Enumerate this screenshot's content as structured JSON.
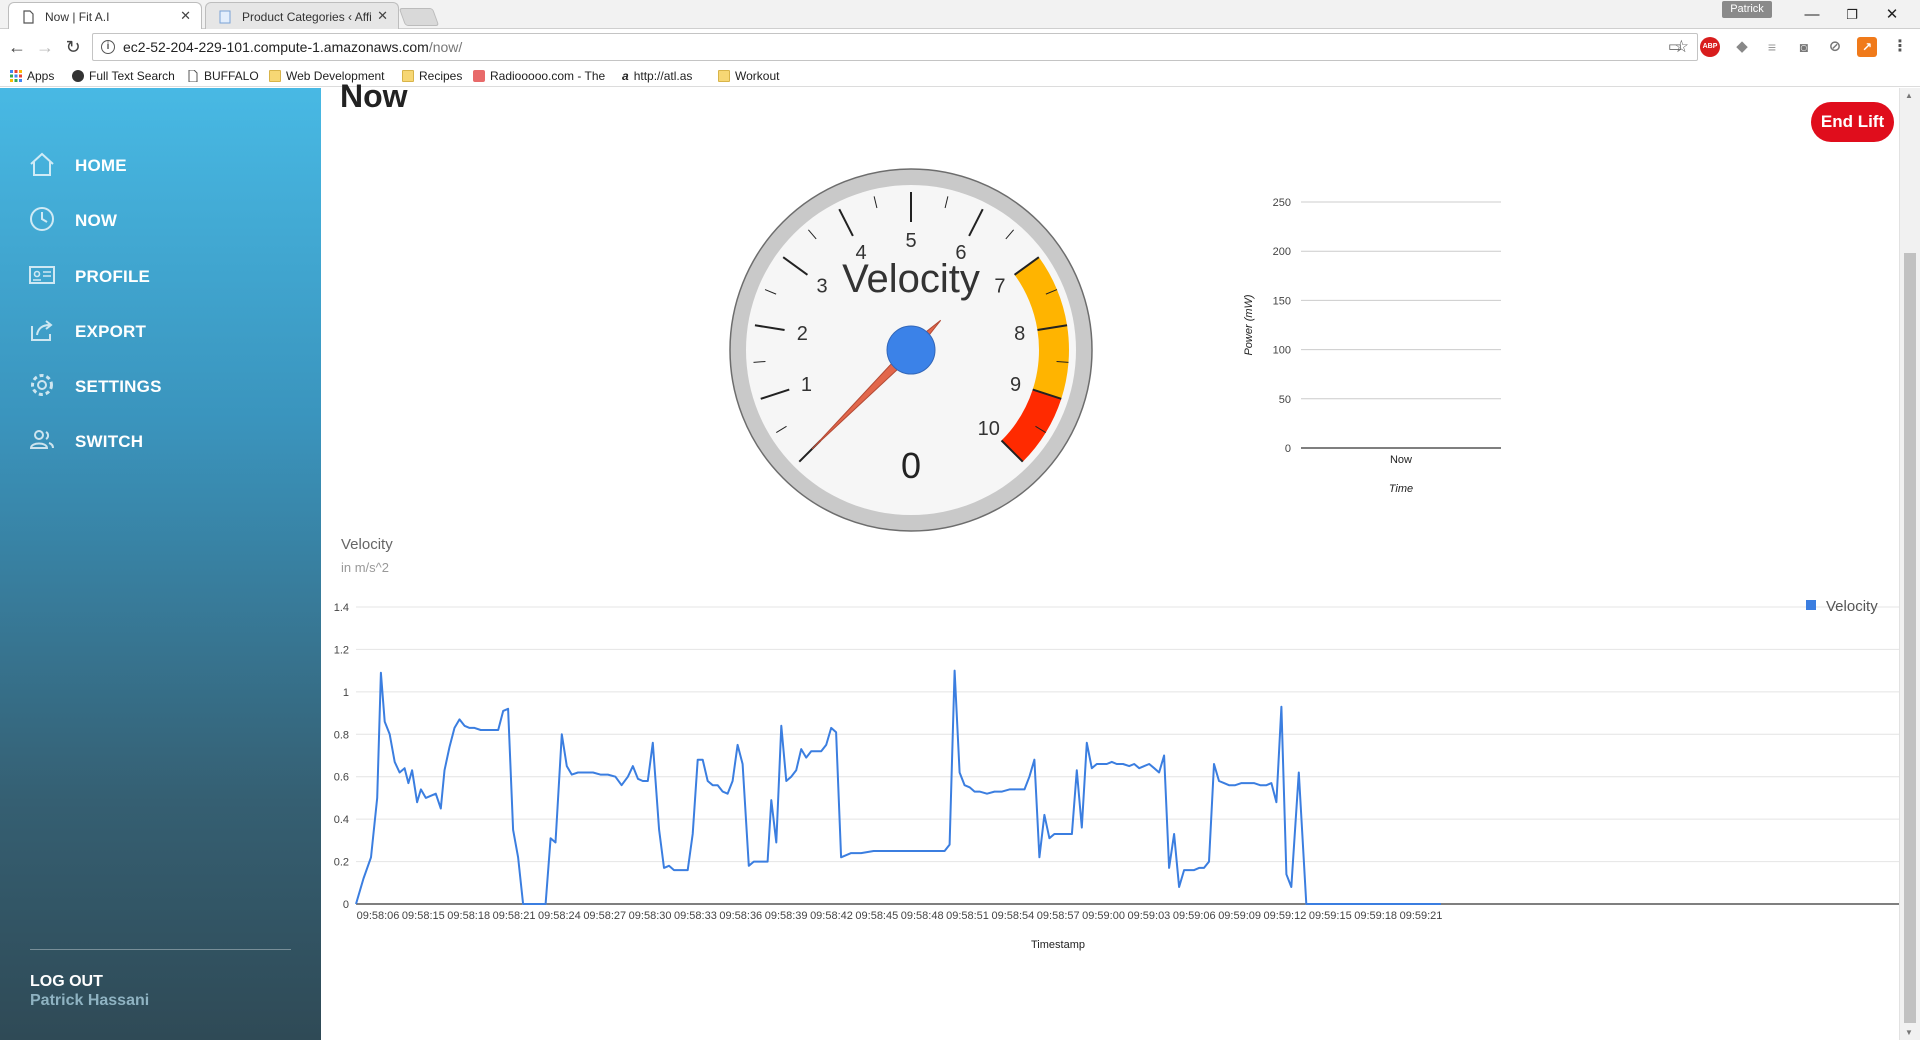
{
  "browser": {
    "tabs": [
      {
        "title": "Now | Fit A.I",
        "active": true
      },
      {
        "title": "Product Categories ‹ Affi",
        "active": false
      }
    ],
    "profile": "Patrick",
    "url_host": "ec2-52-204-229-101.compute-1.amazonaws.com",
    "url_path": "/now/",
    "bookmarks": [
      "Apps",
      "Full Text Search",
      "BUFFALO",
      "Web Development",
      "Recipes",
      "Radiooooo.com - The",
      "http://atl.as",
      "Workout"
    ],
    "extension_icons": [
      "cast-icon",
      "adblock-icon",
      "extension-icon",
      "camera-icon",
      "compass-icon",
      "trend-icon",
      "menu-icon"
    ]
  },
  "sidebar": {
    "items": [
      {
        "label": "HOME",
        "icon": "home-icon"
      },
      {
        "label": "NOW",
        "icon": "clock-icon"
      },
      {
        "label": "PROFILE",
        "icon": "id-card-icon"
      },
      {
        "label": "EXPORT",
        "icon": "export-icon"
      },
      {
        "label": "SETTINGS",
        "icon": "gear-icon"
      },
      {
        "label": "SWITCH",
        "icon": "users-icon"
      }
    ],
    "logout_label": "LOG OUT",
    "user_name": "Patrick Hassani"
  },
  "page": {
    "title": "Now",
    "end_lift_label": "End Lift"
  },
  "chart_data": [
    {
      "type": "gauge",
      "title": "Velocity",
      "min": 0,
      "max": 10,
      "value": 0,
      "value_label": "0",
      "major_ticks": [
        "0",
        "1",
        "2",
        "3",
        "4",
        "5",
        "6",
        "7",
        "8",
        "9",
        "10"
      ],
      "bands": [
        {
          "from": 7,
          "to": 9,
          "color": "#ffb400"
        },
        {
          "from": 9,
          "to": 10,
          "color": "#ff2a00"
        }
      ],
      "needle_color": "#e2674b",
      "hub_color": "#3b82e8"
    },
    {
      "type": "bar",
      "categories": [
        "Now"
      ],
      "values": [
        0
      ],
      "xlabel": "Time",
      "ylabel": "Power (mW)",
      "ylim": [
        0,
        250
      ],
      "yticks": [
        0,
        50,
        100,
        150,
        200,
        250
      ],
      "grid": true
    },
    {
      "type": "line",
      "title": "Velocity",
      "subtitle": "in m/s^2",
      "xlabel": "Timestamp",
      "ylabel": "",
      "ylim": [
        0,
        1.4
      ],
      "yticks": [
        0,
        0.2,
        0.4,
        0.6,
        0.8,
        1,
        1.2,
        1.4
      ],
      "ytick_labels": [
        "0",
        "0.2",
        "0.4",
        "0.6",
        "0.8",
        "1",
        "1.2",
        "1.4"
      ],
      "xlim": [
        0,
        75
      ],
      "xtick_labels": [
        "09:58:06",
        "09:58:15",
        "09:58:18",
        "09:58:21",
        "09:58:24",
        "09:58:27",
        "09:58:30",
        "09:58:33",
        "09:58:36",
        "09:58:39",
        "09:58:42",
        "09:58:45",
        "09:58:48",
        "09:58:51",
        "09:58:54",
        "09:58:57",
        "09:59:00",
        "09:59:03",
        "09:59:06",
        "09:59:09",
        "09:59:12",
        "09:59:15",
        "09:59:18",
        "09:59:21"
      ],
      "grid": true,
      "legend": "right",
      "series": [
        {
          "name": "Velocity",
          "color": "#3b7ee0",
          "points": [
            [
              0,
              0
            ],
            [
              0.6,
              0.12
            ],
            [
              1.2,
              0.22
            ],
            [
              1.7,
              0.5
            ],
            [
              2.0,
              1.09
            ],
            [
              2.3,
              0.86
            ],
            [
              2.7,
              0.8
            ],
            [
              3.1,
              0.67
            ],
            [
              3.5,
              0.62
            ],
            [
              3.9,
              0.64
            ],
            [
              4.2,
              0.57
            ],
            [
              4.5,
              0.63
            ],
            [
              4.9,
              0.48
            ],
            [
              5.2,
              0.54
            ],
            [
              5.6,
              0.5
            ],
            [
              6.0,
              0.51
            ],
            [
              6.4,
              0.52
            ],
            [
              6.8,
              0.45
            ],
            [
              7.1,
              0.63
            ],
            [
              7.5,
              0.74
            ],
            [
              7.9,
              0.83
            ],
            [
              8.3,
              0.87
            ],
            [
              8.7,
              0.84
            ],
            [
              9.1,
              0.83
            ],
            [
              9.5,
              0.83
            ],
            [
              10.0,
              0.82
            ],
            [
              10.5,
              0.82
            ],
            [
              11.0,
              0.82
            ],
            [
              11.4,
              0.82
            ],
            [
              11.8,
              0.91
            ],
            [
              12.2,
              0.92
            ],
            [
              12.6,
              0.35
            ],
            [
              13.0,
              0.22
            ],
            [
              13.4,
              0
            ],
            [
              14.5,
              0
            ],
            [
              15.2,
              0
            ],
            [
              15.6,
              0.31
            ],
            [
              16.0,
              0.29
            ],
            [
              16.5,
              0.8
            ],
            [
              16.9,
              0.65
            ],
            [
              17.3,
              0.61
            ],
            [
              17.8,
              0.62
            ],
            [
              18.4,
              0.62
            ],
            [
              19.0,
              0.62
            ],
            [
              19.6,
              0.61
            ],
            [
              20.2,
              0.61
            ],
            [
              20.8,
              0.6
            ],
            [
              21.3,
              0.56
            ],
            [
              21.8,
              0.6
            ],
            [
              22.2,
              0.65
            ],
            [
              22.6,
              0.59
            ],
            [
              23.0,
              0.58
            ],
            [
              23.4,
              0.58
            ],
            [
              23.8,
              0.76
            ],
            [
              24.3,
              0.35
            ],
            [
              24.7,
              0.17
            ],
            [
              25.1,
              0.18
            ],
            [
              25.5,
              0.16
            ],
            [
              25.9,
              0.16
            ],
            [
              26.3,
              0.16
            ],
            [
              26.6,
              0.16
            ],
            [
              27.0,
              0.33
            ],
            [
              27.4,
              0.68
            ],
            [
              27.8,
              0.68
            ],
            [
              28.2,
              0.58
            ],
            [
              28.6,
              0.56
            ],
            [
              29.0,
              0.56
            ],
            [
              29.4,
              0.53
            ],
            [
              29.8,
              0.52
            ],
            [
              30.2,
              0.58
            ],
            [
              30.6,
              0.75
            ],
            [
              31.0,
              0.66
            ],
            [
              31.5,
              0.18
            ],
            [
              31.9,
              0.2
            ],
            [
              32.3,
              0.2
            ],
            [
              32.7,
              0.2
            ],
            [
              33.0,
              0.2
            ],
            [
              33.3,
              0.49
            ],
            [
              33.7,
              0.29
            ],
            [
              34.1,
              0.84
            ],
            [
              34.5,
              0.58
            ],
            [
              34.9,
              0.6
            ],
            [
              35.3,
              0.63
            ],
            [
              35.7,
              0.73
            ],
            [
              36.1,
              0.69
            ],
            [
              36.5,
              0.72
            ],
            [
              36.9,
              0.72
            ],
            [
              37.3,
              0.72
            ],
            [
              37.7,
              0.75
            ],
            [
              38.1,
              0.83
            ],
            [
              38.5,
              0.81
            ],
            [
              38.9,
              0.22
            ],
            [
              39.3,
              0.23
            ],
            [
              39.7,
              0.24
            ],
            [
              40.5,
              0.24
            ],
            [
              41.5,
              0.25
            ],
            [
              42.5,
              0.25
            ],
            [
              43.5,
              0.25
            ],
            [
              44.5,
              0.25
            ],
            [
              45.5,
              0.25
            ],
            [
              46.5,
              0.25
            ],
            [
              47.2,
              0.25
            ],
            [
              47.6,
              0.28
            ],
            [
              48.0,
              1.1
            ],
            [
              48.4,
              0.62
            ],
            [
              48.8,
              0.56
            ],
            [
              49.2,
              0.55
            ],
            [
              49.6,
              0.53
            ],
            [
              50.0,
              0.53
            ],
            [
              50.6,
              0.52
            ],
            [
              51.2,
              0.53
            ],
            [
              51.8,
              0.53
            ],
            [
              52.4,
              0.54
            ],
            [
              53.0,
              0.54
            ],
            [
              53.6,
              0.54
            ],
            [
              54.0,
              0.6
            ],
            [
              54.4,
              0.68
            ],
            [
              54.8,
              0.22
            ],
            [
              55.2,
              0.42
            ],
            [
              55.6,
              0.31
            ],
            [
              56.0,
              0.33
            ],
            [
              56.5,
              0.33
            ],
            [
              57.0,
              0.33
            ],
            [
              57.4,
              0.33
            ],
            [
              57.8,
              0.63
            ],
            [
              58.2,
              0.36
            ],
            [
              58.6,
              0.76
            ],
            [
              59.0,
              0.64
            ],
            [
              59.4,
              0.66
            ],
            [
              59.8,
              0.66
            ],
            [
              60.2,
              0.66
            ],
            [
              60.6,
              0.67
            ],
            [
              61.0,
              0.66
            ],
            [
              61.5,
              0.66
            ],
            [
              62.0,
              0.65
            ],
            [
              62.4,
              0.66
            ],
            [
              62.8,
              0.64
            ],
            [
              63.2,
              0.65
            ],
            [
              63.6,
              0.66
            ],
            [
              64.0,
              0.64
            ],
            [
              64.4,
              0.62
            ],
            [
              64.8,
              0.7
            ],
            [
              65.2,
              0.17
            ],
            [
              65.6,
              0.33
            ],
            [
              66.0,
              0.08
            ],
            [
              66.4,
              0.16
            ],
            [
              66.8,
              0.16
            ],
            [
              67.2,
              0.16
            ],
            [
              67.6,
              0.17
            ],
            [
              68.0,
              0.17
            ],
            [
              68.4,
              0.2
            ],
            [
              68.8,
              0.66
            ],
            [
              69.2,
              0.58
            ],
            [
              69.6,
              0.57
            ],
            [
              70.0,
              0.56
            ],
            [
              70.5,
              0.56
            ],
            [
              71.0,
              0.57
            ],
            [
              71.5,
              0.57
            ],
            [
              72.0,
              0.57
            ],
            [
              72.5,
              0.56
            ],
            [
              73.0,
              0.56
            ],
            [
              73.4,
              0.57
            ],
            [
              73.8,
              0.48
            ],
            [
              74.2,
              0.93
            ],
            [
              74.6,
              0.14
            ],
            [
              75.0,
              0.08
            ],
            [
              75.6,
              0.62
            ],
            [
              76.2,
              0
            ],
            [
              79,
              0
            ],
            [
              83,
              0
            ],
            [
              87,
              0
            ]
          ]
        }
      ]
    }
  ]
}
